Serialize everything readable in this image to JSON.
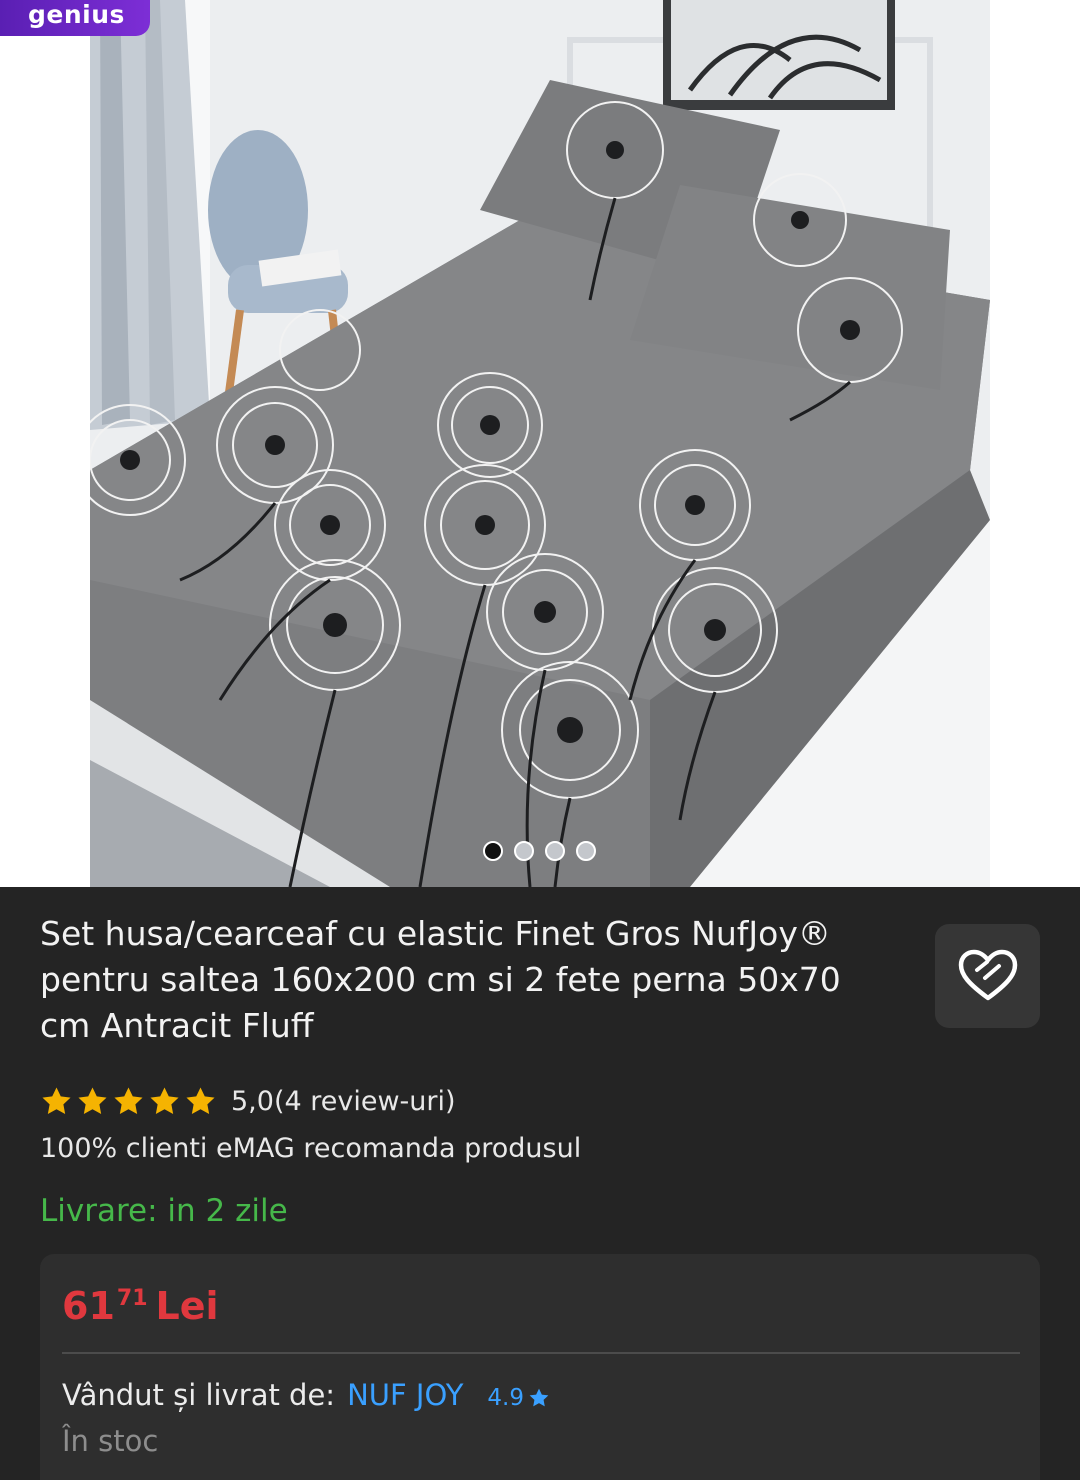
{
  "badge": {
    "label": "genius"
  },
  "gallery": {
    "image_alt": "grey dandelion-print fitted sheet and pillowcases on bed",
    "slide_count": 4,
    "active_slide": 1
  },
  "product": {
    "title": "Set husa/cearceaf cu elastic Finet Gros NufJoy® pentru saltea 160x200 cm si 2 fete perna 50x70 cm Antracit Fluff",
    "favorite_icon": "heart-icon"
  },
  "rating": {
    "stars": 5,
    "score": "5,0",
    "count_label": "(4 review-uri)",
    "star_color": "#f5b301"
  },
  "recommendation": "100% clienti eMAG recomanda produsul",
  "delivery": "Livrare: in 2 zile",
  "price": {
    "integer": "61",
    "cents": "71",
    "currency": "Lei",
    "color": "#e0383e"
  },
  "seller": {
    "label": "Vândut și livrat de:",
    "name": "NUF JOY",
    "rating": "4.9",
    "rating_icon": "star-icon",
    "link_color": "#3aa0ff"
  },
  "stock": "În stoc"
}
